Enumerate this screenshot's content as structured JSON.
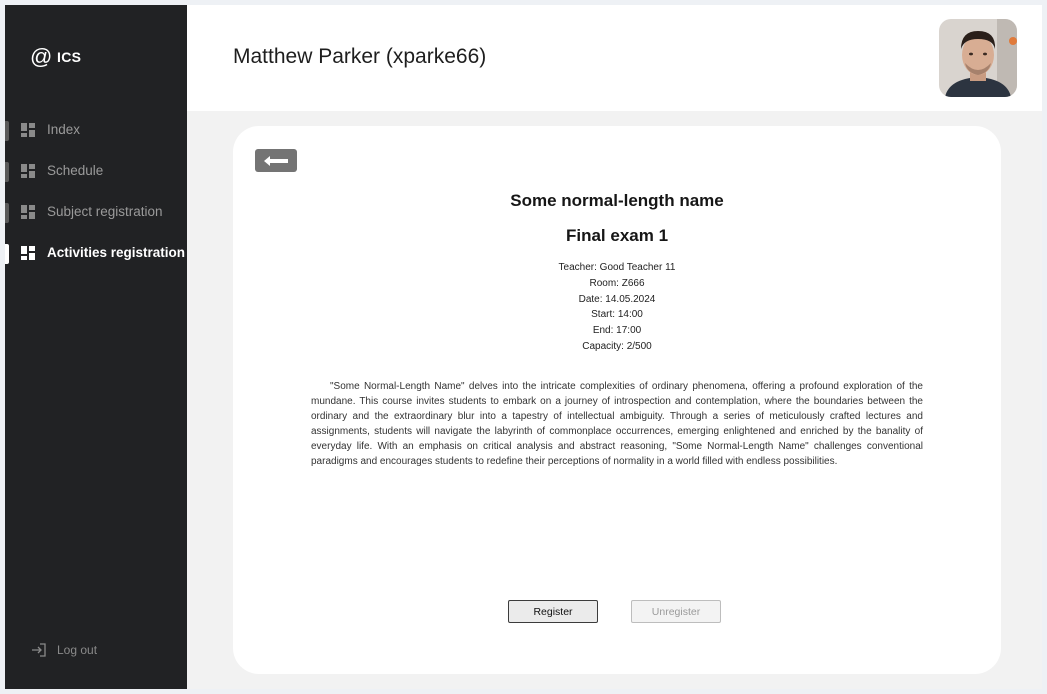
{
  "app": {
    "logo_symbol": "@",
    "brand": "ICS"
  },
  "sidebar": {
    "items": [
      {
        "label": "Index",
        "icon": "dashboard-icon",
        "active": false
      },
      {
        "label": "Schedule",
        "icon": "dashboard-icon",
        "active": false
      },
      {
        "label": "Subject registration",
        "icon": "dashboard-icon",
        "active": false
      },
      {
        "label": "Activities registration",
        "icon": "dashboard-icon",
        "active": true
      }
    ],
    "logout": {
      "label": "Log out",
      "icon": "logout-icon"
    }
  },
  "header": {
    "user_name": "Matthew Parker (xparke66)",
    "avatar_icon": "user-avatar"
  },
  "activity": {
    "back_icon": "arrow-left-icon",
    "subject_name": "Some normal-length name",
    "activity_name": "Final exam 1",
    "teacher": "Teacher: Good Teacher 11",
    "room": "Room: Z666",
    "date": "Date: 14.05.2024",
    "start": "Start: 14:00",
    "end": "End: 17:00",
    "capacity": "Capacity: 2/500",
    "description": "\"Some Normal-Length Name\" delves into the intricate complexities of ordinary phenomena, offering a profound exploration of the mundane. This course invites students to embark on a journey of introspection and contemplation, where the boundaries between the ordinary and the extraordinary blur into a tapestry of intellectual ambiguity. Through a series of meticulously crafted lectures and assignments, students will navigate the labyrinth of commonplace occurrences, emerging enlightened and enriched by the banality of everyday life. With an emphasis on critical analysis and abstract reasoning, \"Some Normal-Length Name\" challenges conventional paradigms and encourages students to redefine their perceptions of normality in a world filled with endless possibilities.",
    "register_label": "Register",
    "unregister_label": "Unregister"
  },
  "colors": {
    "sidebar_bg": "#212224",
    "accent_white": "#ffffff",
    "back_button": "#747474"
  }
}
